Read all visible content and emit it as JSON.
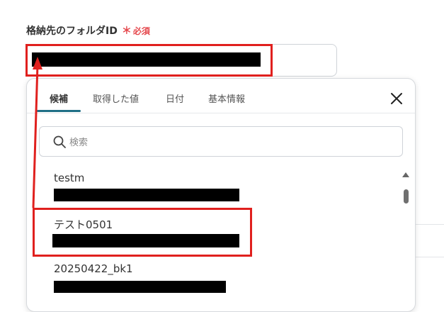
{
  "field": {
    "label": "格納先のフォルダID",
    "required_mark": "＊",
    "required_text": "必須"
  },
  "dropdown": {
    "tabs": [
      {
        "label": "候補",
        "active": true
      },
      {
        "label": "取得した値",
        "active": false
      },
      {
        "label": "日付",
        "active": false
      },
      {
        "label": "基本情報",
        "active": false
      }
    ],
    "search_placeholder": "検索",
    "items": [
      {
        "label": "testm"
      },
      {
        "label": "テスト0501"
      },
      {
        "label": "20250422_bk1"
      }
    ]
  },
  "colors": {
    "annotation": "#e0201e",
    "required": "#e5484d",
    "tab_accent": "#1f6f86"
  }
}
